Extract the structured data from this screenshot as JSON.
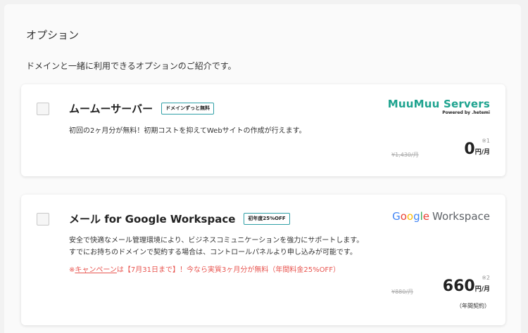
{
  "section": {
    "title": "オプション",
    "description": "ドメインと一緒に利用できるオプションのご紹介です。"
  },
  "options": [
    {
      "title": "ムームーサーバー",
      "badge": "ドメインずっと無料",
      "description": "初回の2ヶ月分が無料！初期コストを抑えてWebサイトの作成が行えます。",
      "logo_main": "MuuMuu Servers",
      "logo_sub": "Powered by .hetemi",
      "note": "※1",
      "old_price": "¥1,430/月",
      "price": "0",
      "price_unit": "円/月"
    },
    {
      "title": "メール for Google Workspace",
      "badge": "初年度25%OFF",
      "description_1": "安全で快適なメール管理環境により、ビジネスコミュニケーションを強力にサポートします。",
      "description_2": "すでにお持ちのドメインで契約する場合は、コントロールパネルより申し込みが可能です。",
      "campaign_prefix": "※",
      "campaign_link": "キャンペーン",
      "campaign_text": "は【7月31日まで】！今なら実質3ヶ月分が無料（年間料金25%OFF）",
      "logo_google": [
        "G",
        "o",
        "o",
        "g",
        "l",
        "e"
      ],
      "logo_workspace": "Workspace",
      "note": "※2",
      "old_price": "¥880/月",
      "price": "660",
      "price_unit": "円/月",
      "annual": "（年間契約）"
    }
  ],
  "colors": {
    "accent": "#2f9fa6",
    "muumuu_green": "#1ea38f",
    "campaign_red": "#e8534e"
  }
}
